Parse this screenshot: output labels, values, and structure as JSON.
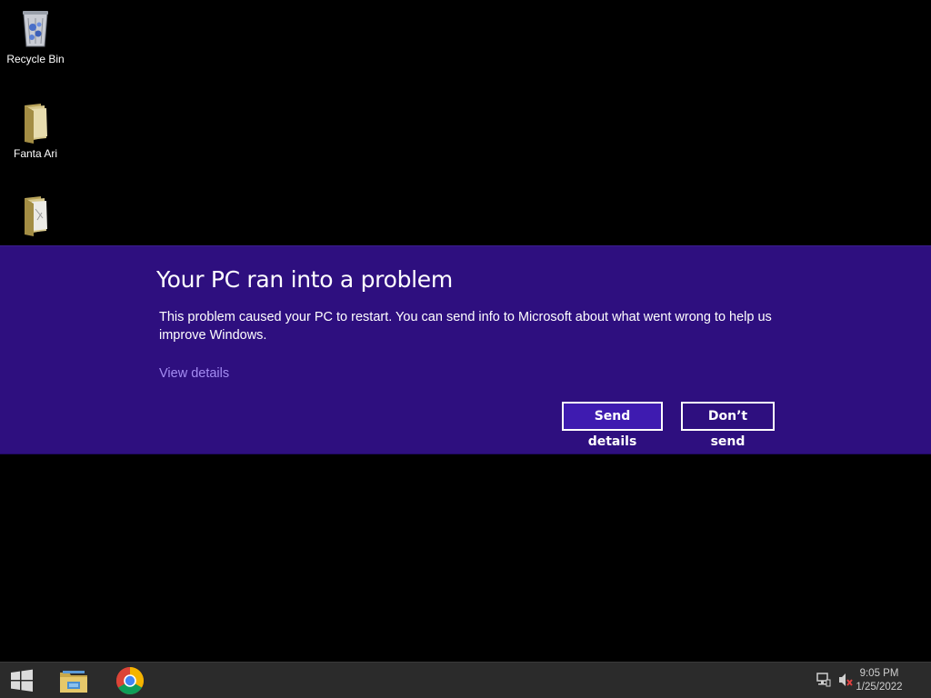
{
  "desktop": {
    "icons": [
      {
        "label": "Recycle Bin",
        "icon": "recycle-bin-icon"
      },
      {
        "label": "Fanta Ari",
        "icon": "folder-icon"
      },
      {
        "label": "",
        "icon": "folder-icon"
      }
    ]
  },
  "error_dialog": {
    "title": "Your PC ran into a problem",
    "message": "This problem caused your PC to restart. You can send info to Microsoft about what went wrong to help us improve Windows.",
    "view_details_link": "View details",
    "send_button": "Send details",
    "dont_send_button": "Don’t send",
    "colors": {
      "background": "#2e0f7f",
      "primary_button": "#3e1bb0",
      "link": "#a48cf2"
    }
  },
  "taskbar": {
    "start_icon": "windows-logo-icon",
    "pinned": [
      {
        "name": "File Explorer",
        "icon": "file-explorer-icon"
      },
      {
        "name": "Google Chrome",
        "icon": "chrome-icon"
      }
    ],
    "tray": {
      "network_icon": "network-icon",
      "volume_icon": "volume-muted-icon"
    },
    "clock": {
      "time": "9:05 PM",
      "date": "1/25/2022"
    }
  }
}
